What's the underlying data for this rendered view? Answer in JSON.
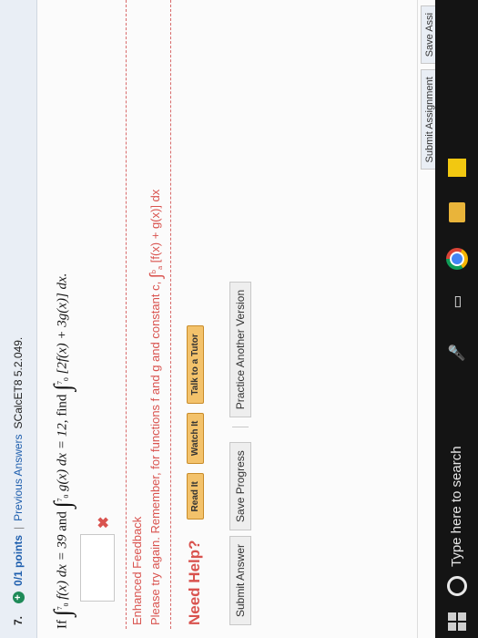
{
  "question": {
    "number": "7.",
    "points": "0/1 points",
    "separator": "|",
    "previous_answers": "Previous Answers",
    "code": "SCalcET8 5.2.049."
  },
  "problem": {
    "if": "If",
    "int1_upper": "7",
    "int1_lower": "0",
    "f_expr": "f(x) dx = 39",
    "and": "and",
    "int2_upper": "7",
    "int2_lower": "0",
    "g_expr": "g(x) dx = 12,",
    "find": "find",
    "int3_upper": "7",
    "int3_lower": "0",
    "target_expr": "[2f(x) + 3g(x)] dx."
  },
  "answer": {
    "value": "",
    "result_icon": "✖"
  },
  "feedback": {
    "title": "Enhanced Feedback",
    "text": "Please try again. Remember, for functions f and g and constant c,",
    "int_upper": "b",
    "int_lower": "a",
    "formula": "[f(x) + g(x)] dx"
  },
  "help": {
    "title": "Need Help?",
    "buttons": [
      "Read It",
      "Watch It",
      "Talk to a Tutor"
    ]
  },
  "actions": {
    "submit": "Submit Answer",
    "save": "Save Progress",
    "practice": "Practice Another Version"
  },
  "bottom": {
    "submit_assignment": "Submit Assignment",
    "save_assignment": "Save Assi"
  },
  "taskbar": {
    "search_placeholder": "Type here to search"
  },
  "colors": {
    "accent": "#1f5fae",
    "error": "#d9534f",
    "help_button": "#f3c26b",
    "correct_badge": "#1e8a58"
  }
}
